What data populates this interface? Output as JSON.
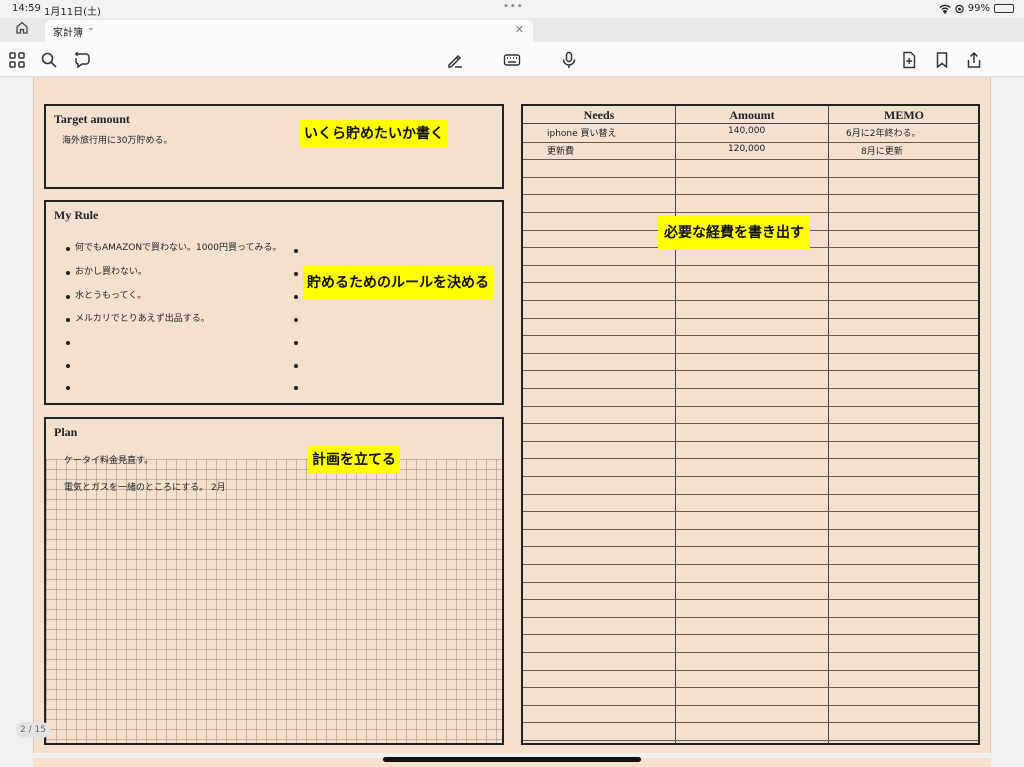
{
  "status_bar": {
    "time": "14:59",
    "date": "1月11日(土)",
    "battery": "99%"
  },
  "tab": {
    "title": "家計簿"
  },
  "toolbar": {
    "left_icons": [
      "grid-icon",
      "search-icon",
      "ai-lasso-icon"
    ],
    "center_icons": [
      "pen-icon",
      "keyboard-icon",
      "microphone-icon"
    ],
    "right_icons": [
      "add-page-icon",
      "bookmark-icon",
      "share-icon"
    ]
  },
  "page": {
    "target": {
      "title": "Target amount",
      "text": "海外旅行用に30万貯める。",
      "note": "いくら貯めたいか書く"
    },
    "rule": {
      "title": "My Rule",
      "items": [
        "何でもAMAZONで買わない。1000円買ってみる。",
        "おかし買わない。",
        "水とうもってく。",
        "メルカリでとりあえず出品する。"
      ],
      "note": "貯めるためのルールを決める"
    },
    "plan": {
      "title": "Plan",
      "lines": [
        "ケータイ料金見直す。",
        "電気とガスを一緒のところにする。 2月"
      ],
      "note": "計画を立てる"
    },
    "needs": {
      "headers": [
        "Needs",
        "Amoumt",
        "MEMO"
      ],
      "rows": [
        [
          "iphone 買い替え",
          "140,000",
          "6月に2年終わる。"
        ],
        [
          "更新費",
          "120,000",
          "8月に更新"
        ]
      ],
      "note": "必要な経費を書き出す"
    }
  },
  "page_indicator": "2 / 15"
}
